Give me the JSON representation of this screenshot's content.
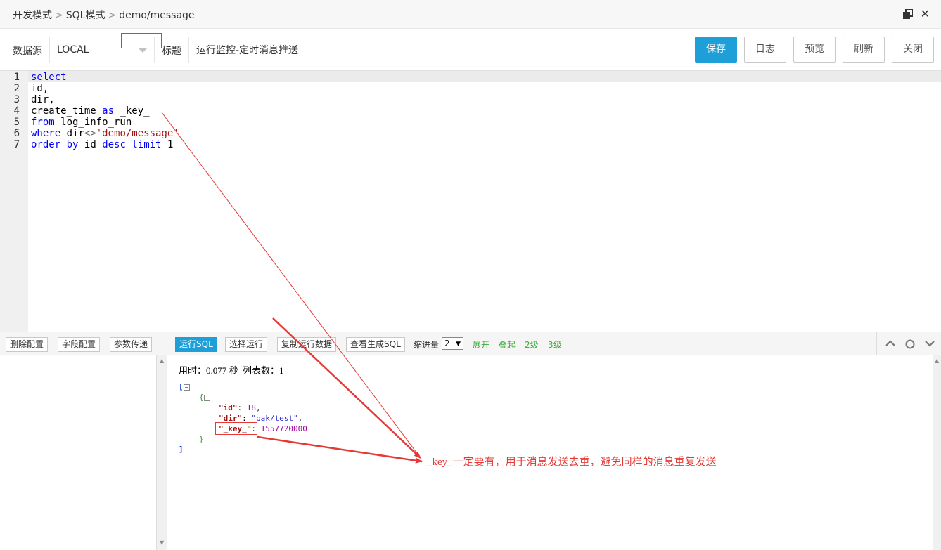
{
  "breadcrumb": {
    "item1": "开发模式",
    "item2": "SQL模式",
    "item3": "demo/message",
    "sep": ">"
  },
  "window": {
    "close_glyph": "✕"
  },
  "toolbar": {
    "datasource_label": "数据源",
    "datasource_value": "LOCAL",
    "title_label": "标题",
    "title_value": "运行监控-定时消息推送",
    "save": "保存",
    "log": "日志",
    "preview": "预览",
    "refresh": "刷新",
    "close": "关闭"
  },
  "editor": {
    "line_numbers": [
      "1",
      "2",
      "3",
      "4",
      "5",
      "6",
      "7"
    ],
    "lines": {
      "l1_kw": "select",
      "l2": "id,",
      "l3": "dir,",
      "l4_a": "create_time ",
      "l4_kw": "as",
      "l4_b": " _key_",
      "l5_kw": "from",
      "l5_b": " log_info_run",
      "l6_kw": "where",
      "l6_b": " dir",
      "l6_op": "<>",
      "l6_str": "'demo/message'",
      "l7_kw1": "order",
      "l7_kw2": "by",
      "l7_mid": "id",
      "l7_kw3": "desc",
      "l7_kw4": "limit",
      "l7_num": "1"
    }
  },
  "bottom_toolbar": {
    "delete_config": "删除配置",
    "field_config": "字段配置",
    "param_pass": "参数传递",
    "run_sql": "运行SQL",
    "run_selected": "选择运行",
    "copy_run_data": "复制运行数据",
    "view_generated_sql": "查看生成SQL",
    "indent_label": "缩进量",
    "indent_value": "2",
    "expand": "展开",
    "collapse": "叠起",
    "level2": "2级",
    "level3": "3级"
  },
  "result": {
    "timing": "用时：0.077 秒  列表数：1",
    "open_bracket": "[",
    "close_bracket": "]",
    "open_brace": "{",
    "close_brace": "}",
    "key_id": "\"id\"",
    "val_id": "18",
    "key_dir": "\"dir\"",
    "val_dir": "\"bak/test\"",
    "key_key": "\"_key_\"",
    "val_key": "1557720000",
    "toggle": "⊟"
  },
  "annotation": {
    "text": "_key_一定要有，用于消息发送去重，避免同样的消息重复发送",
    "color": "#e53935"
  },
  "colors": {
    "primary": "#1e9fd8",
    "link_green": "#3cae3c",
    "annotation_red": "#e53935"
  }
}
